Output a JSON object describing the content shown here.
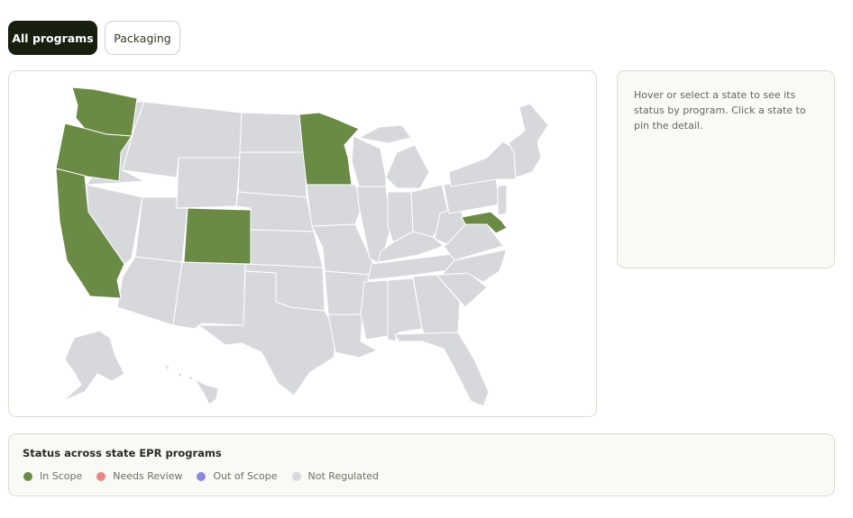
{
  "tabs": [
    {
      "label": "All programs",
      "active": true
    },
    {
      "label": "Packaging",
      "active": false
    }
  ],
  "detail_panel": {
    "placeholder": "Hover or select a state to see its status by program. Click a state to pin the detail."
  },
  "legend": {
    "title": "Status across state EPR programs",
    "items": [
      {
        "label": "In Scope",
        "color": "#6b8a45"
      },
      {
        "label": "Needs Review",
        "color": "#e58a83"
      },
      {
        "label": "Out of Scope",
        "color": "#8c88dc"
      },
      {
        "label": "Not Regulated",
        "color": "#d6d8dc"
      }
    ]
  },
  "map": {
    "in_scope_states": [
      "Washington",
      "Oregon",
      "California",
      "Colorado",
      "Minnesota",
      "Maryland"
    ],
    "in_scope_color": "#6b8a45",
    "not_regulated_color": "#d6d8dc"
  }
}
